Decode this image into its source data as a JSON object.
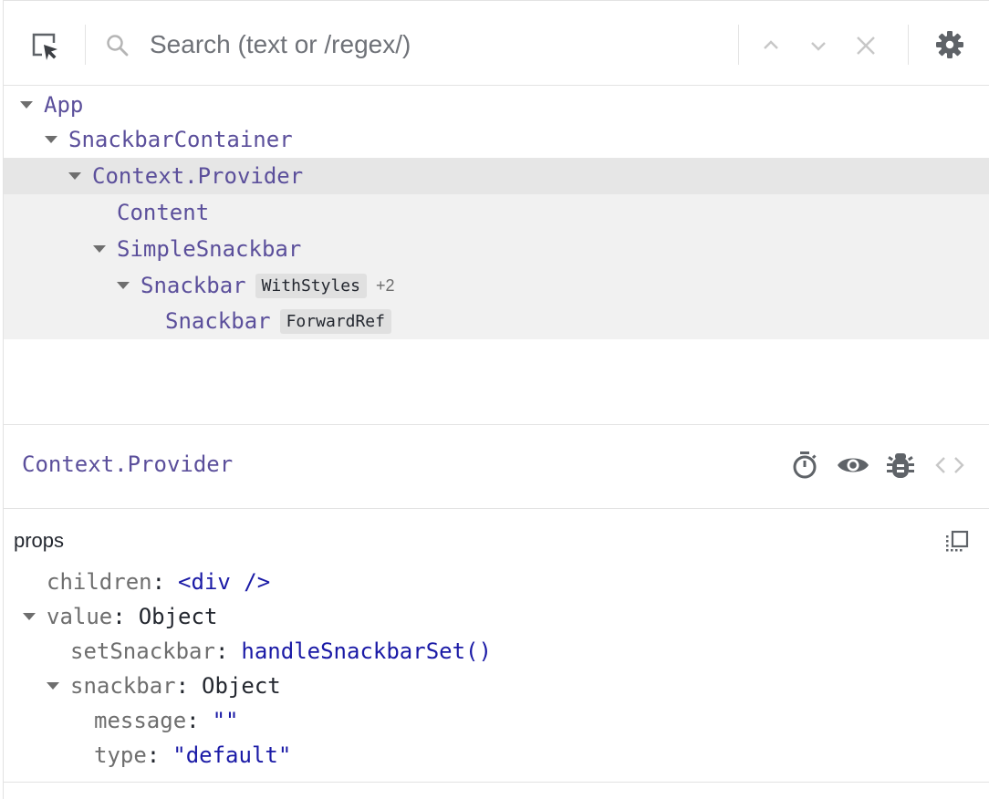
{
  "toolbar": {
    "search_placeholder": "Search (text or /regex/)"
  },
  "tree": {
    "rows": [
      {
        "name": "App"
      },
      {
        "name": "SnackbarContainer"
      },
      {
        "name": "Context.Provider"
      },
      {
        "name": "Content"
      },
      {
        "name": "SimpleSnackbar"
      },
      {
        "name": "Snackbar",
        "hoc": "WithStyles",
        "hoc_more": "+2"
      },
      {
        "name": "Snackbar",
        "hoc": "ForwardRef"
      }
    ]
  },
  "inspected": {
    "component_name": "Context.Provider"
  },
  "props": {
    "title": "props",
    "items": [
      {
        "key": "children",
        "value": "<div />"
      },
      {
        "key": "value",
        "value": "Object"
      },
      {
        "key": "setSnackbar",
        "value": "handleSnackbarSet()"
      },
      {
        "key": "snackbar",
        "value": "Object"
      },
      {
        "key": "message",
        "value": "\"\""
      },
      {
        "key": "type",
        "value": "\"default\""
      }
    ]
  },
  "colors": {
    "component_name": "#5b4f9b",
    "value_blue": "#1a1aa6",
    "selected_row": "#e6e6e6",
    "owned_rows": "#f1f1f1"
  },
  "icons": [
    "select-element-icon",
    "search-icon",
    "chevron-up-icon",
    "chevron-down-icon",
    "close-icon",
    "gear-icon",
    "stopwatch-icon",
    "eye-icon",
    "bug-icon",
    "code-icon",
    "copy-icon"
  ]
}
